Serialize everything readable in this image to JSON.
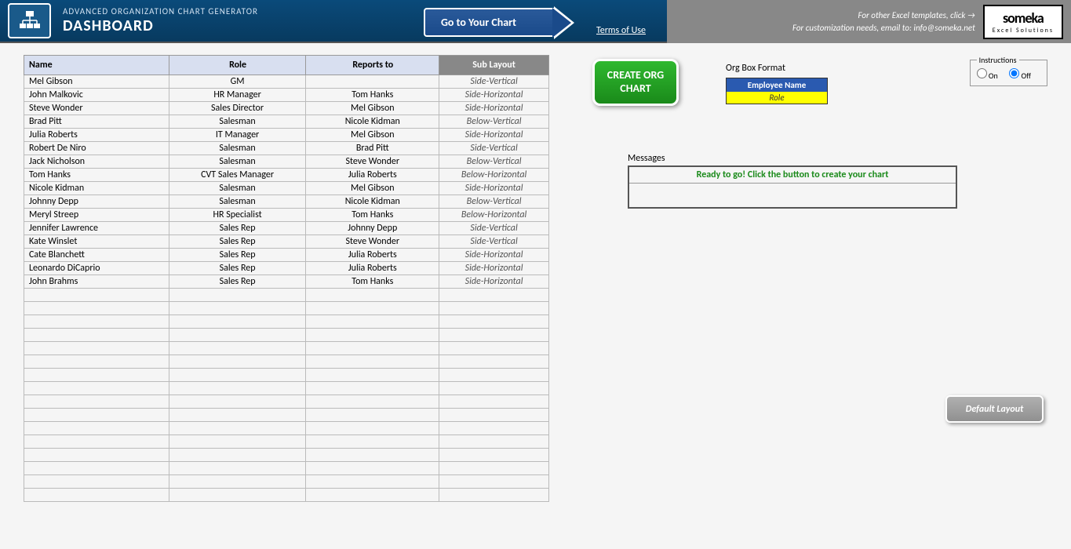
{
  "header": {
    "title_small": "ADVANCED ORGANIZATION CHART GENERATOR",
    "title_main": "DASHBOARD",
    "goto_chart": "Go to Your Chart",
    "terms": "Terms of Use",
    "right_line1": "For other Excel templates, click →",
    "right_line2": "For customization needs, email to: info@someka.net",
    "logo_brand": "someka",
    "logo_sub": "Excel Solutions"
  },
  "table": {
    "headers": {
      "name": "Name",
      "role": "Role",
      "reports": "Reports to",
      "layout": "Sub Layout"
    },
    "rows": [
      {
        "name": "Mel Gibson",
        "role": "GM",
        "reports": "",
        "layout": "Side-Vertical"
      },
      {
        "name": "John Malkovic",
        "role": "HR Manager",
        "reports": "Tom Hanks",
        "layout": "Side-Horizontal"
      },
      {
        "name": "Steve Wonder",
        "role": "Sales Director",
        "reports": "Mel Gibson",
        "layout": "Side-Horizontal"
      },
      {
        "name": "Brad Pitt",
        "role": "Salesman",
        "reports": "Nicole Kidman",
        "layout": "Below-Vertical"
      },
      {
        "name": "Julia Roberts",
        "role": "IT Manager",
        "reports": "Mel Gibson",
        "layout": "Side-Horizontal"
      },
      {
        "name": "Robert De Niro",
        "role": "Salesman",
        "reports": "Brad Pitt",
        "layout": "Side-Vertical"
      },
      {
        "name": "Jack Nicholson",
        "role": "Salesman",
        "reports": "Steve Wonder",
        "layout": "Below-Vertical"
      },
      {
        "name": "Tom Hanks",
        "role": "CVT Sales Manager",
        "reports": "Julia Roberts",
        "layout": "Below-Horizontal"
      },
      {
        "name": "Nicole Kidman",
        "role": "Salesman",
        "reports": "Mel Gibson",
        "layout": "Side-Horizontal"
      },
      {
        "name": "Johnny Depp",
        "role": "Salesman",
        "reports": "Nicole Kidman",
        "layout": "Below-Vertical"
      },
      {
        "name": "Meryl Streep",
        "role": "HR Specialist",
        "reports": "Tom Hanks",
        "layout": "Below-Horizontal"
      },
      {
        "name": "Jennifer Lawrence",
        "role": "Sales Rep",
        "reports": "Johnny Depp",
        "layout": "Side-Vertical"
      },
      {
        "name": "Kate Winslet",
        "role": "Sales Rep",
        "reports": "Steve Wonder",
        "layout": "Side-Vertical"
      },
      {
        "name": "Cate Blanchett",
        "role": "Sales Rep",
        "reports": "Julia Roberts",
        "layout": "Side-Horizontal"
      },
      {
        "name": "Leonardo DiCaprio",
        "role": "Sales Rep",
        "reports": "Julia Roberts",
        "layout": "Side-Horizontal"
      },
      {
        "name": "John Brahms",
        "role": "Sales Rep",
        "reports": "Tom Hanks",
        "layout": "Side-Horizontal"
      }
    ],
    "blank_rows": 16
  },
  "buttons": {
    "create": "CREATE ORG CHART",
    "default_layout": "Default Layout"
  },
  "org_format": {
    "label": "Org Box Format",
    "emp": "Employee Name",
    "role": "Role"
  },
  "instructions": {
    "legend": "Instructions",
    "on": "On",
    "off": "Off",
    "selected": "off"
  },
  "messages": {
    "label": "Messages",
    "ready": "Ready to go! Click the button to create your chart"
  }
}
